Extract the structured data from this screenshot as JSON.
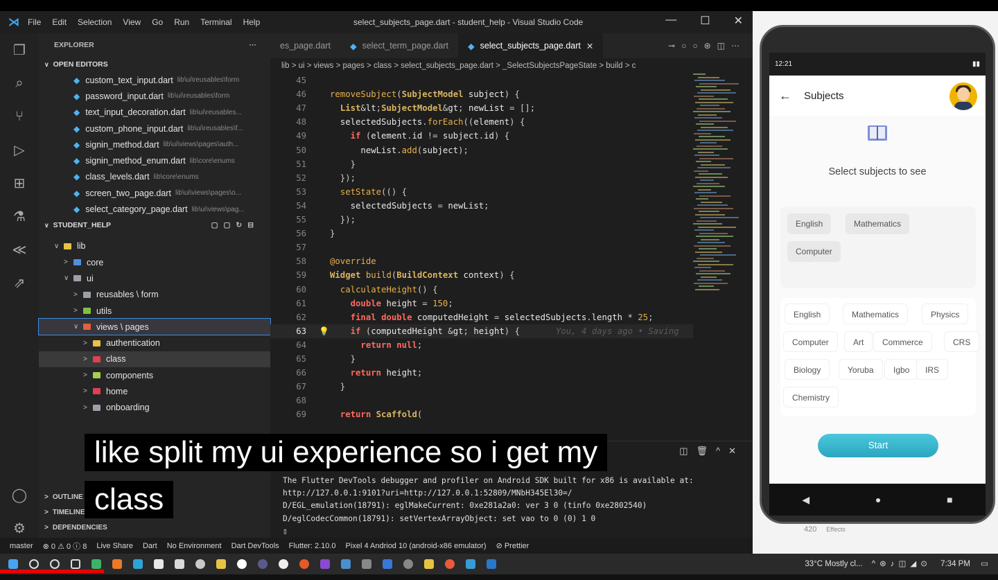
{
  "vscode": {
    "title": "select_subjects_page.dart - student_help - Visual Studio Code",
    "menu": [
      "File",
      "Edit",
      "Selection",
      "View",
      "Go",
      "Run",
      "Terminal",
      "Help"
    ],
    "explorer_label": "EXPLORER",
    "open_editors_label": "OPEN EDITORS",
    "open_editors": [
      {
        "name": "custom_text_input.dart",
        "path": "lib\\ui\\reusables\\form"
      },
      {
        "name": "password_input.dart",
        "path": "lib\\ui\\reusables\\form"
      },
      {
        "name": "text_input_decoration.dart",
        "path": "lib\\ui\\reusables..."
      },
      {
        "name": "custom_phone_input.dart",
        "path": "lib\\ui\\reusables\\f..."
      },
      {
        "name": "signin_method.dart",
        "path": "lib\\ui\\views\\pages\\auth..."
      },
      {
        "name": "signin_method_enum.dart",
        "path": "lib\\core\\enums"
      },
      {
        "name": "class_levels.dart",
        "path": "lib\\core\\enums"
      },
      {
        "name": "screen_two_page.dart",
        "path": "lib\\ui\\views\\pages\\o..."
      },
      {
        "name": "select_category_page.dart",
        "path": "lib\\ui\\views\\pag..."
      }
    ],
    "project_label": "STUDENT_HELP",
    "tree": [
      {
        "label": "lib",
        "indent": 1,
        "color": "#e8c244",
        "chev": "∨"
      },
      {
        "label": "core",
        "indent": 2,
        "color": "#4f8fe0",
        "chev": ">"
      },
      {
        "label": "ui",
        "indent": 2,
        "color": "#9aa0a6",
        "chev": "∨"
      },
      {
        "label": "reusables \\ form",
        "indent": 3,
        "color": "#9aa0a6",
        "chev": ">"
      },
      {
        "label": "utils",
        "indent": 3,
        "color": "#7cc142",
        "chev": ">"
      },
      {
        "label": "views \\ pages",
        "indent": 3,
        "color": "#e06040",
        "chev": "∨"
      },
      {
        "label": "authentication",
        "indent": 4,
        "color": "#e8c244",
        "chev": ">"
      },
      {
        "label": "class",
        "indent": 4,
        "color": "#e04050",
        "chev": ">"
      },
      {
        "label": "components",
        "indent": 4,
        "color": "#a6d04a",
        "chev": ">"
      },
      {
        "label": "home",
        "indent": 4,
        "color": "#e04050",
        "chev": ">"
      },
      {
        "label": "onboarding",
        "indent": 4,
        "color": "#9aa0a6",
        "chev": ">"
      }
    ],
    "bottom_sections": [
      "OUTLINE",
      "TIMELINE",
      "DEPENDENCIES"
    ],
    "tabs": [
      {
        "label": "es_page.dart",
        "active": false
      },
      {
        "label": "select_term_page.dart",
        "active": false
      },
      {
        "label": "select_subjects_page.dart",
        "active": true
      }
    ],
    "breadcrumb": "lib > ui > views > pages > class > select_subjects_page.dart > _SelectSubjectsPageState > build > c",
    "code": [
      {
        "n": "45",
        "t": ""
      },
      {
        "n": "46",
        "t": "removeSubject(SubjectModel subject) {"
      },
      {
        "n": "47",
        "t": "  List<SubjectModel> newList = [];"
      },
      {
        "n": "48",
        "t": "  selectedSubjects.forEach((element) {"
      },
      {
        "n": "49",
        "t": "    if (element.id != subject.id) {"
      },
      {
        "n": "50",
        "t": "      newList.add(subject);"
      },
      {
        "n": "51",
        "t": "    }"
      },
      {
        "n": "52",
        "t": "  });"
      },
      {
        "n": "53",
        "t": "  setState(() {"
      },
      {
        "n": "54",
        "t": "    selectedSubjects = newList;"
      },
      {
        "n": "55",
        "t": "  });"
      },
      {
        "n": "56",
        "t": "}"
      },
      {
        "n": "57",
        "t": ""
      },
      {
        "n": "58",
        "t": "@override"
      },
      {
        "n": "59",
        "t": "Widget build(BuildContext context) {"
      },
      {
        "n": "60",
        "t": "  calculateHeight() {"
      },
      {
        "n": "61",
        "t": "    double height = 150;"
      },
      {
        "n": "62",
        "t": "    final double computedHeight = selectedSubjects.length * 25;"
      },
      {
        "n": "63",
        "t": "    if (computedHeight > height) {"
      },
      {
        "n": "64",
        "t": "      return null;"
      },
      {
        "n": "65",
        "t": "    }"
      },
      {
        "n": "66",
        "t": "    return height;"
      },
      {
        "n": "67",
        "t": "  }"
      },
      {
        "n": "68",
        "t": ""
      },
      {
        "n": "69",
        "t": "  return Scaffold("
      }
    ],
    "ghost_text": "You, 4 days ago • Saving",
    "terminal_lines": [
      "The Flutter DevTools debugger and profiler on Android SDK built for x86 is available at:",
      "http://127.0.0.1:9101?uri=http://127.0.0.1:52809/MNbH345El30=/",
      "D/EGL_emulation(18791): eglMakeCurrent: 0xe281a2a0: ver 3 0 (tinfo 0xe2802540)",
      "D/eglCodecCommon(18791): setVertexArrayObject: set vao to 0 (0) 1 0",
      "▯"
    ],
    "status": [
      "master",
      "⊗ 0 ⚠ 0 ⓘ 8",
      "Live Share",
      "Dart",
      "No Environment",
      "Dart DevTools",
      "Flutter: 2.10.0",
      "Pixel 4 Andriod 10 (android-x86 emulator)",
      "⊘ Prettier"
    ]
  },
  "subtitle": {
    "line1": "like split my ui experience so i get my",
    "line2": "class"
  },
  "phone": {
    "time": "12:21",
    "battery": "",
    "title": "Subjects",
    "prompt": "Select subjects to see",
    "selected": [
      "English",
      "Mathematics",
      "Computer"
    ],
    "all_subjects": [
      "English",
      "Mathematics",
      "Physics",
      "Computer",
      "Art",
      "Commerce",
      "CRS",
      "Biology",
      "Yoruba",
      "Igbo",
      "IRS",
      "Chemistry"
    ],
    "start_label": "Start",
    "under_count": "420",
    "under_label": "Effects"
  },
  "taskbar": {
    "weather": "33°C Mostly cl...",
    "time": "7:34 PM"
  },
  "colors": {
    "accent": "#3a8ee6",
    "start_button": "#38b6cf",
    "dart_blue": "#4fb3f0"
  }
}
